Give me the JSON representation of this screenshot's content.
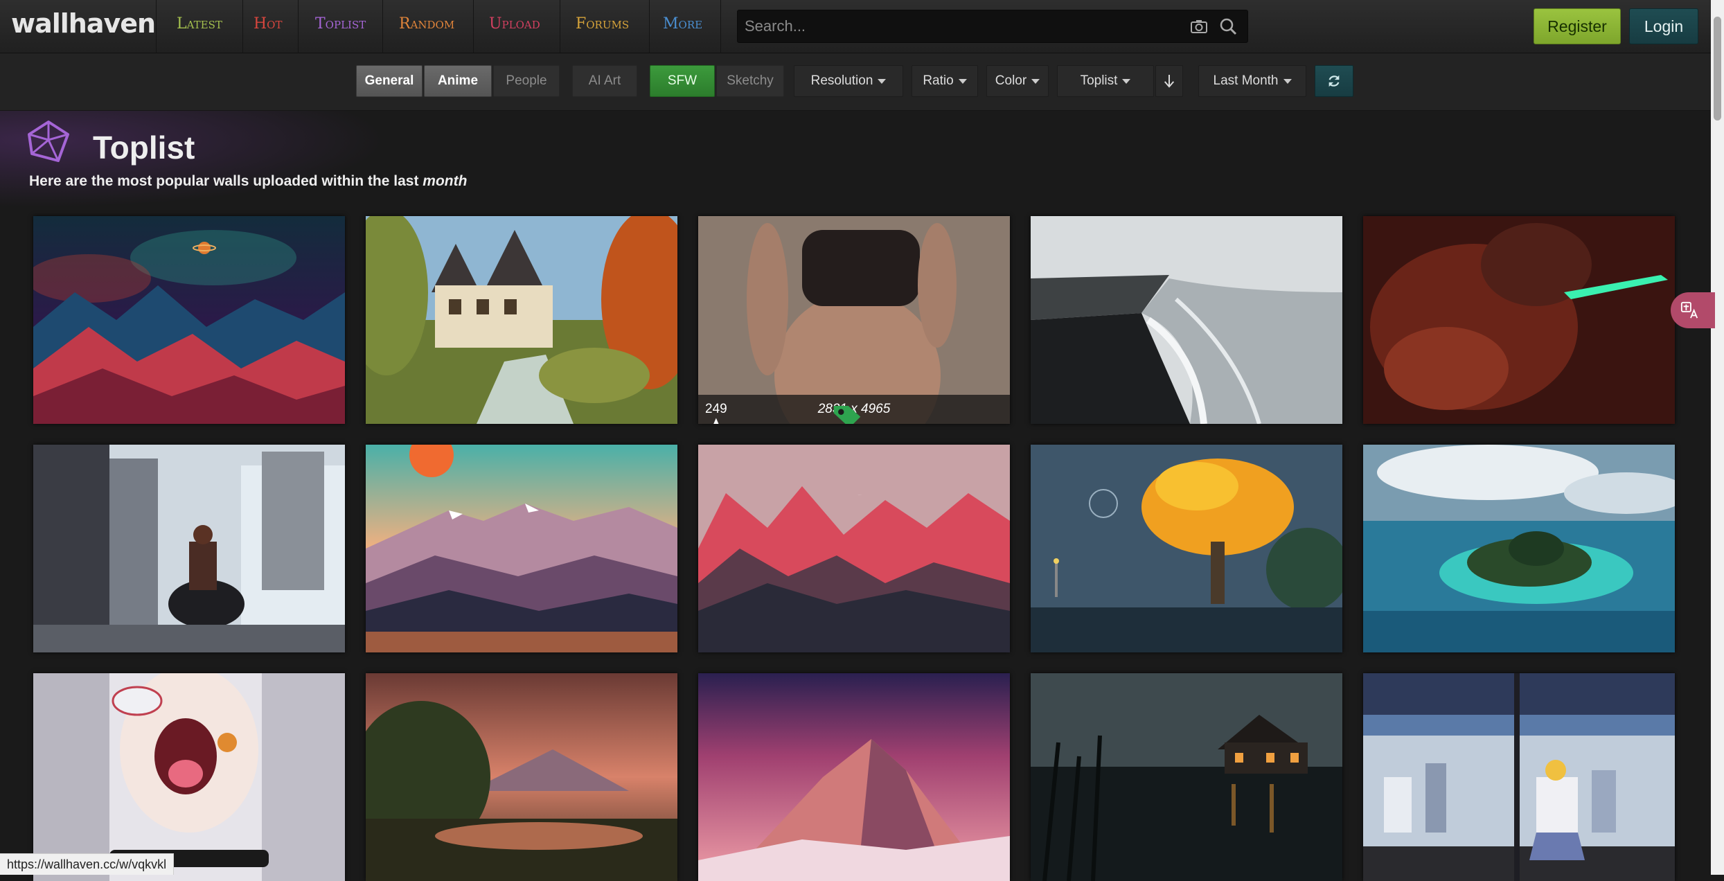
{
  "header": {
    "logo": "wallhaven",
    "nav": [
      {
        "label": "Latest",
        "color": "#a4c04e"
      },
      {
        "label": "Hot",
        "color": "#d8463e"
      },
      {
        "label": "Toplist",
        "color": "#a565d6"
      },
      {
        "label": "Random",
        "color": "#e0843a"
      },
      {
        "label": "Upload",
        "color": "#d24060"
      },
      {
        "label": "Forums",
        "color": "#d4a23a"
      },
      {
        "label": "More",
        "color": "#4a8ed0"
      }
    ],
    "search_placeholder": "Search...",
    "register_label": "Register",
    "login_label": "Login"
  },
  "filters": {
    "categories": [
      {
        "label": "General",
        "active": true
      },
      {
        "label": "Anime",
        "active": true
      },
      {
        "label": "People",
        "active": false
      }
    ],
    "ai_art": {
      "label": "AI Art",
      "active": false
    },
    "purity": [
      {
        "label": "SFW",
        "active": true
      },
      {
        "label": "Sketchy",
        "active": false
      }
    ],
    "resolution_label": "Resolution",
    "ratio_label": "Ratio",
    "color_label": "Color",
    "sorting_label": "Toplist",
    "toprange_label": "Last Month"
  },
  "page": {
    "title": "Toplist",
    "subtitle_prefix": "Here are the most popular walls uploaded within the last",
    "subtitle_em": "month"
  },
  "thumbs": [
    {
      "subject": "cosmic neon mountains"
    },
    {
      "subject": "autumn cottage and waterfall"
    },
    {
      "subject": "portrait photo",
      "favorites": "249",
      "resolution": "2831 x 4965",
      "tag_color": "#2ea44f"
    },
    {
      "subject": "black sand beach waves"
    },
    {
      "subject": "dark red creature with glowing blade"
    },
    {
      "subject": "anime girl on motorcycle in city"
    },
    {
      "subject": "sunset mountain landscape"
    },
    {
      "subject": "red mountains and crescent moon"
    },
    {
      "subject": "pixel art orange tree"
    },
    {
      "subject": "tropical island aerial"
    },
    {
      "subject": "anime girl close-up"
    },
    {
      "subject": "mountain lake painting"
    },
    {
      "subject": "pink snowy mountain peak"
    },
    {
      "subject": "lake house at night"
    },
    {
      "subject": "anime girl at window overlooking city"
    }
  ],
  "status_bar": {
    "url": "https://wallhaven.cc/w/vqkvkl"
  },
  "colors": {
    "accent_purple": "#a565d6",
    "register_green": "#8fb63a",
    "login_teal": "#1f4c52",
    "sfw_green": "#33903a",
    "bg": "#1a1a1a"
  }
}
